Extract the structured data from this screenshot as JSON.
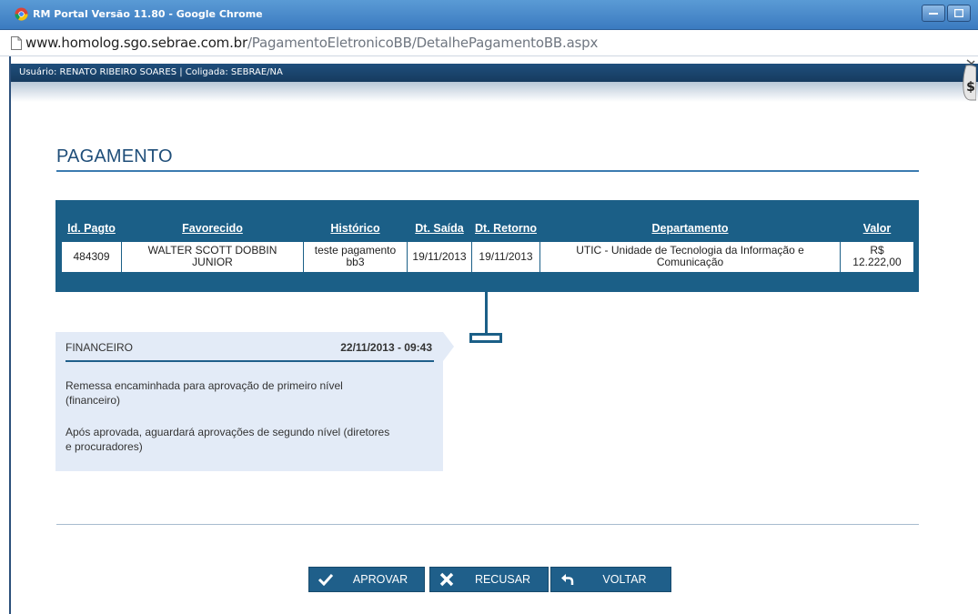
{
  "window": {
    "title": "RM Portal Versão 11.80 - Google Chrome"
  },
  "address": {
    "host": "www.homolog.sgo.sebrae.com.br",
    "path": "/PagamentoEletronicoBB/DetalhePagamentoBB.aspx"
  },
  "userbar": {
    "text": "Usuário: RENATO RIBEIRO SOARES | Coligada: SEBRAE/NA"
  },
  "page": {
    "title": "PAGAMENTO"
  },
  "table": {
    "headers": [
      "Id. Pagto",
      "Favorecido",
      "Histórico",
      "Dt. Saída",
      "Dt. Retorno",
      "Departamento",
      "Valor"
    ],
    "row": {
      "id": "484309",
      "favorecido_1": "WALTER SCOTT DOBBIN",
      "favorecido_2": "JUNIOR",
      "historico_1": "teste pagamento",
      "historico_2": "bb3",
      "dt_saida": "19/11/2013",
      "dt_retorno": "19/11/2013",
      "departamento_1": "UTIC - Unidade de Tecnologia da Informação e",
      "departamento_2": "Comunicação",
      "valor_1": "R$",
      "valor_2": "12.222,00"
    }
  },
  "timeline": {
    "department": "FINANCEIRO",
    "datetime": "22/11/2013 - 09:43",
    "message_1": "Remessa encaminhada para aprovação de primeiro nível (financeiro)",
    "message_2": "Após aprovada, aguardará aprovações de segundo nível (diretores e procuradores)"
  },
  "buttons": {
    "approve": "APROVAR",
    "refuse": "RECUSAR",
    "back": "VOLTAR"
  },
  "colors": {
    "panel": "#1b5f87",
    "title": "#1f4e79",
    "timeline_bg": "#e3ebf7"
  },
  "icons": {
    "chrome": "chrome-icon",
    "page": "page-icon",
    "money": "money-bag-icon",
    "approve": "check-icon",
    "refuse": "x-icon",
    "back": "undo-arrow-icon"
  }
}
